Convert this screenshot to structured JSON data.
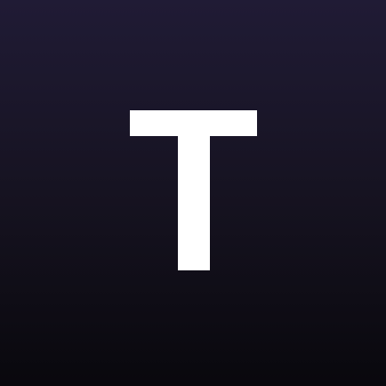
{
  "icon": {
    "letter": "T",
    "colors": {
      "background_top": "#201b35",
      "background_bottom": "#09080d",
      "glyph": "#ffffff"
    }
  }
}
